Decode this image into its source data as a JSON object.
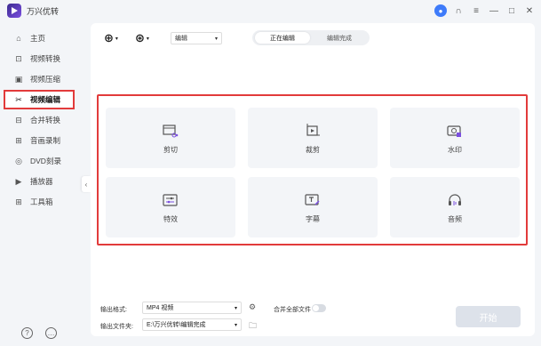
{
  "app": {
    "title": "万兴优转"
  },
  "sidebar": {
    "items": [
      {
        "label": "主页",
        "icon": "home-icon"
      },
      {
        "label": "视频转换",
        "icon": "convert-icon"
      },
      {
        "label": "视频压缩",
        "icon": "compress-icon"
      },
      {
        "label": "视频编辑",
        "icon": "scissors-icon",
        "active": true
      },
      {
        "label": "合并转换",
        "icon": "merge-icon"
      },
      {
        "label": "音画录制",
        "icon": "record-icon"
      },
      {
        "label": "DVD刻录",
        "icon": "dvd-icon"
      },
      {
        "label": "播放器",
        "icon": "player-icon"
      },
      {
        "label": "工具箱",
        "icon": "toolbox-icon"
      }
    ]
  },
  "toolbar": {
    "mode_select": "编辑",
    "tabs": [
      "正在编辑",
      "编辑完成"
    ]
  },
  "tiles": [
    {
      "label": "剪切",
      "icon": "cut-icon"
    },
    {
      "label": "裁剪",
      "icon": "crop-icon"
    },
    {
      "label": "水印",
      "icon": "watermark-icon"
    },
    {
      "label": "特效",
      "icon": "effects-icon"
    },
    {
      "label": "字幕",
      "icon": "subtitle-icon"
    },
    {
      "label": "音频",
      "icon": "audio-icon"
    }
  ],
  "footer": {
    "format_label": "输出格式:",
    "format_value": "MP4 视频",
    "merge_label": "合并全部文件",
    "folder_label": "输出文件夹:",
    "folder_value": "E:\\万兴优转\\编辑完成",
    "start_label": "开始"
  },
  "colors": {
    "accent": "#3e7bfa",
    "highlight": "#e23b3b"
  }
}
